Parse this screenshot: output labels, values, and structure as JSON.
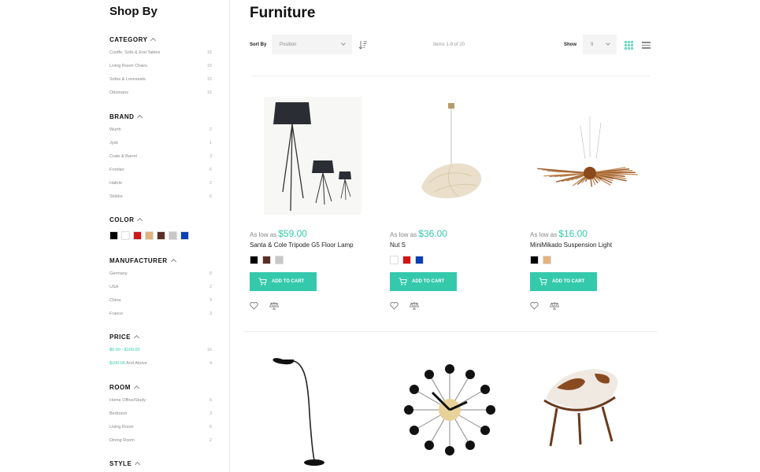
{
  "sidebar": {
    "title": "Shop By",
    "category": {
      "heading": "CATEGORY",
      "items": [
        {
          "label": "Cooffe, Sofa & End Tables",
          "count": "15"
        },
        {
          "label": "Living Room Chairs",
          "count": "15"
        },
        {
          "label": "Sofas & Loveseats",
          "count": "15"
        },
        {
          "label": "Ottomans",
          "count": "15"
        }
      ]
    },
    "brand": {
      "heading": "BRAND",
      "items": [
        {
          "label": "Wurth",
          "count": "2"
        },
        {
          "label": "Jysk",
          "count": "1"
        },
        {
          "label": "Crate & Barrel",
          "count": "3"
        },
        {
          "label": "Frontier",
          "count": "6"
        },
        {
          "label": "Hafele",
          "count": "2"
        },
        {
          "label": "Stokke",
          "count": "6"
        }
      ]
    },
    "color": {
      "heading": "COLOR",
      "swatches": [
        "#000000",
        "#ffffff",
        "#d0161a",
        "#e3b27d",
        "#5a2f28",
        "#c8c8c8",
        "#0b3fb5"
      ]
    },
    "manufacturer": {
      "heading": "MANUFACTURER",
      "items": [
        {
          "label": "Germany",
          "count": "8"
        },
        {
          "label": "USA",
          "count": "2"
        },
        {
          "label": "China",
          "count": "9"
        },
        {
          "label": "France",
          "count": "3"
        }
      ]
    },
    "price": {
      "heading": "PRICE",
      "items": [
        {
          "label": "$0.00 - $100.00",
          "suffix": "",
          "count": "16"
        },
        {
          "label": "$100.00",
          "suffix": " And Above",
          "count": "4"
        }
      ]
    },
    "room": {
      "heading": "ROOM",
      "items": [
        {
          "label": "Home Office/Study",
          "count": "5"
        },
        {
          "label": "Bedroom",
          "count": "3"
        },
        {
          "label": "Living Room",
          "count": "5"
        },
        {
          "label": "Dining Room",
          "count": "2"
        }
      ]
    },
    "style": {
      "heading": "STYLE"
    }
  },
  "main": {
    "title": "Furniture",
    "toolbar": {
      "sort_label": "Sort By",
      "sort_value": "Position",
      "items_count": "Items 1-9 of 20",
      "show_label": "Show",
      "show_value": "9"
    },
    "cart_label": "ADD TO CART",
    "as_low_as": "As low as",
    "products": [
      {
        "name": "Santa & Cole Tripode G5 Floor Lamp",
        "price": "$59.00",
        "swatches": [
          "#000000",
          "#5a2f28",
          "#c8c8c8"
        ]
      },
      {
        "name": "Nut S",
        "price": "$36.00",
        "swatches": [
          "#ffffff",
          "#d0161a",
          "#0b3fb5"
        ]
      },
      {
        "name": "MiniMikado Suspension Light",
        "price": "$16.00",
        "swatches": [
          "#000000",
          "#e3b27d"
        ]
      }
    ]
  },
  "colors": {
    "accent": "#35c9ac"
  }
}
